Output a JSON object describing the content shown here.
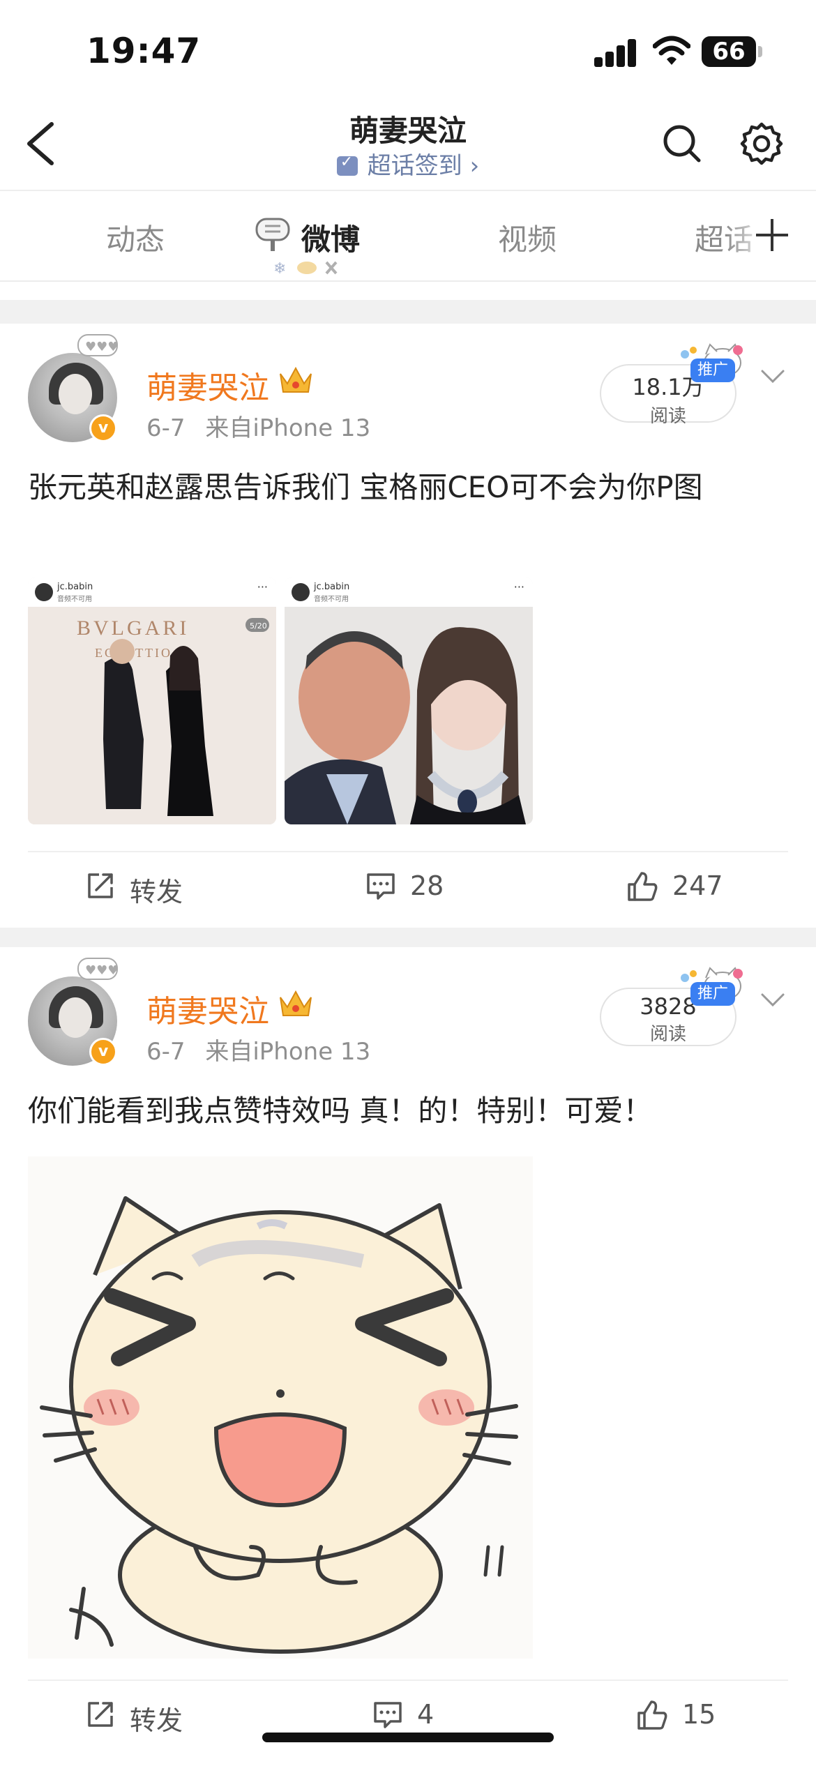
{
  "status_bar": {
    "time": "19:47",
    "battery": "66"
  },
  "header": {
    "title": "萌妻哭泣",
    "subtitle": "超话签到",
    "subtitle_chevron": "›"
  },
  "tabs": [
    {
      "label": "动态",
      "active": false
    },
    {
      "label": "微博",
      "active": true
    },
    {
      "label": "视频",
      "active": false
    },
    {
      "label": "超话",
      "active": false
    }
  ],
  "posts": [
    {
      "username": "萌妻哭泣",
      "date": "6-7",
      "source": "来自iPhone 13",
      "read_count": "18.1万",
      "read_label": "阅读",
      "promo_badge": "推广",
      "text": "张元英和赵露思告诉我们 宝格丽CEO可不会为你P图",
      "images": [
        {
          "handle": "jc.babin",
          "sub": "音频不可用",
          "brand": "BVLGARI",
          "brand2": "ECCETTIO",
          "page": "5/20"
        },
        {
          "handle": "jc.babin",
          "sub": "音频不可用"
        }
      ],
      "repost_label": "转发",
      "comments": "28",
      "likes": "247"
    },
    {
      "username": "萌妻哭泣",
      "date": "6-7",
      "source": "来自iPhone 13",
      "read_count": "3828",
      "read_label": "阅读",
      "promo_badge": "推广",
      "text": "你们能看到我点赞特效吗 真！的！特别！可爱！",
      "repost_label": "转发",
      "comments": "4",
      "likes": "15"
    }
  ],
  "icons": [
    "back-arrow-icon",
    "search-icon",
    "gear-icon",
    "plus-icon",
    "crown-icon",
    "verified-icon",
    "repost-icon",
    "comment-icon",
    "like-icon"
  ],
  "colors": {
    "username": "#f0781e",
    "verified": "#f7a11a",
    "promo": "#3a7ff2",
    "subtitle": "#6b7ea6"
  }
}
